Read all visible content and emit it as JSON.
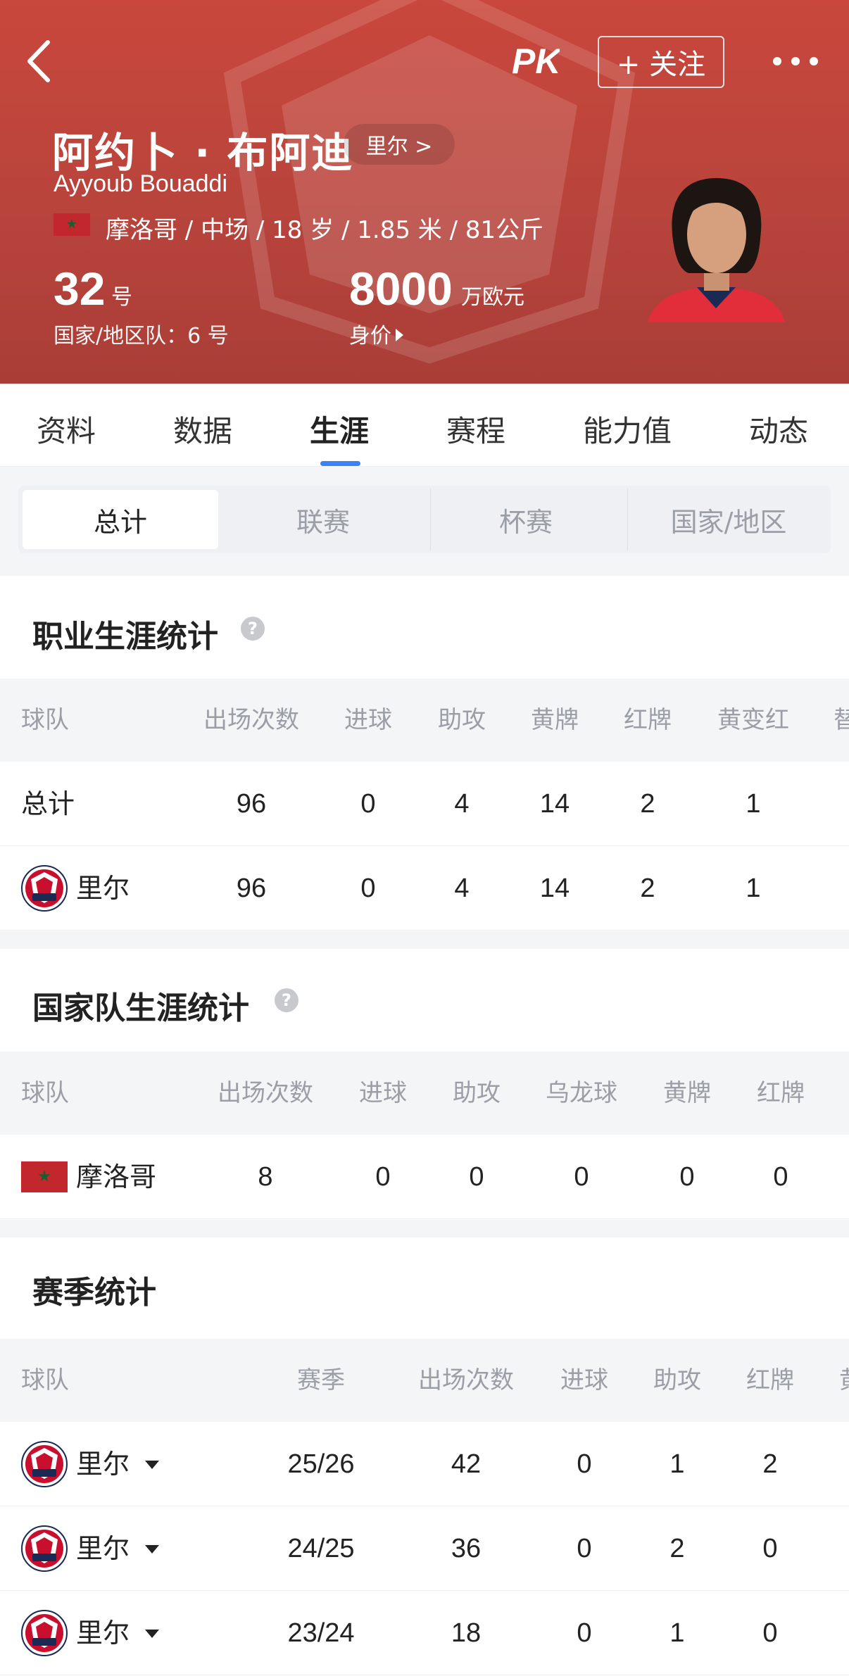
{
  "header": {
    "follow_label": "+ 关注",
    "name_cn": "阿约卜 · 布阿迪",
    "club_link": "里尔 >",
    "name_en": "Ayyoub Bouaddi",
    "info_line": "摩洛哥 / 中场 / 18 岁 / 1.85 米 / 81公斤",
    "shirt_number": "32",
    "shirt_number_unit": "号",
    "national_number": "国家/地区队：6 号",
    "market_value": "8000",
    "market_value_unit": "万欧元",
    "market_value_label": "身价"
  },
  "tabs": [
    "资料",
    "数据",
    "生涯",
    "赛程",
    "能力值",
    "动态"
  ],
  "active_tab": "生涯",
  "segments": [
    "总计",
    "联赛",
    "杯赛",
    "国家/地区"
  ],
  "active_segment": "总计",
  "career": {
    "title": "职业生涯统计",
    "columns": [
      "球队",
      "出场次数",
      "进球",
      "助攻",
      "黄牌",
      "红牌",
      "黄变红",
      "替"
    ],
    "rows": [
      {
        "team": "总计",
        "apps": "96",
        "goals": "0",
        "assists": "4",
        "yellow": "14",
        "red": "2",
        "second_yellow": "1"
      },
      {
        "team": "里尔",
        "apps": "96",
        "goals": "0",
        "assists": "4",
        "yellow": "14",
        "red": "2",
        "second_yellow": "1"
      }
    ]
  },
  "national": {
    "title": "国家队生涯统计",
    "columns": [
      "球队",
      "出场次数",
      "进球",
      "助攻",
      "乌龙球",
      "黄牌",
      "红牌"
    ],
    "rows": [
      {
        "team": "摩洛哥",
        "apps": "8",
        "goals": "0",
        "assists": "0",
        "own_goals": "0",
        "yellow": "0",
        "red": "0"
      }
    ]
  },
  "season": {
    "title": "赛季统计",
    "columns": [
      "球队",
      "赛季",
      "出场次数",
      "进球",
      "助攻",
      "红牌",
      "黄"
    ],
    "rows": [
      {
        "team": "里尔",
        "season": "25/26",
        "apps": "42",
        "goals": "0",
        "assists": "1",
        "red": "2"
      },
      {
        "team": "里尔",
        "season": "24/25",
        "apps": "36",
        "goals": "0",
        "assists": "2",
        "red": "0"
      },
      {
        "team": "里尔",
        "season": "23/24",
        "apps": "18",
        "goals": "0",
        "assists": "1",
        "red": "0"
      }
    ]
  },
  "colors": {
    "header_bg": "#b8443c",
    "accent": "#3c82f6",
    "lille_red": "#c8102e",
    "morocco_red": "#c1272d"
  },
  "icons": [
    "back-arrow-icon",
    "pk-logo-icon",
    "more-dots-icon",
    "help-icon",
    "lille-logo-icon",
    "morocco-flag-icon",
    "dropdown-caret-icon"
  ]
}
